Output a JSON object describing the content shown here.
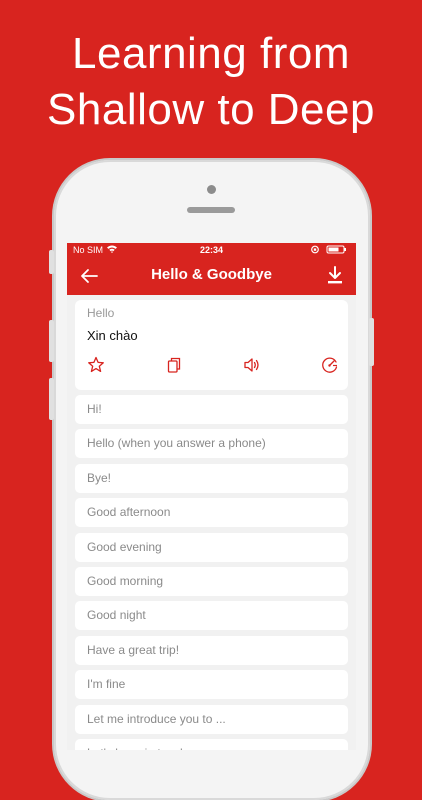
{
  "headline": {
    "line1": "Learning from",
    "line2": "Shallow to Deep"
  },
  "status_bar": {
    "carrier": "No SIM",
    "time": "22:34"
  },
  "nav": {
    "title": "Hello & Goodbye",
    "back_icon": "arrow-left-icon",
    "download_icon": "download-icon"
  },
  "colors": {
    "accent": "#d8241f",
    "icon": "#d8241f",
    "background": "#f1f1f1"
  },
  "main_card": {
    "english": "Hello",
    "vietnamese": "Xin chào",
    "actions": [
      "star-icon",
      "copy-icon",
      "speaker-icon",
      "speed-icon"
    ]
  },
  "phrases": [
    "Hi!",
    "Hello (when you answer a phone)",
    "Bye!",
    "Good afternoon",
    "Good evening",
    "Good morning",
    "Good night",
    "Have a great trip!",
    "I'm fine",
    "Let me introduce you to ...",
    "Let's keep in touch"
  ]
}
